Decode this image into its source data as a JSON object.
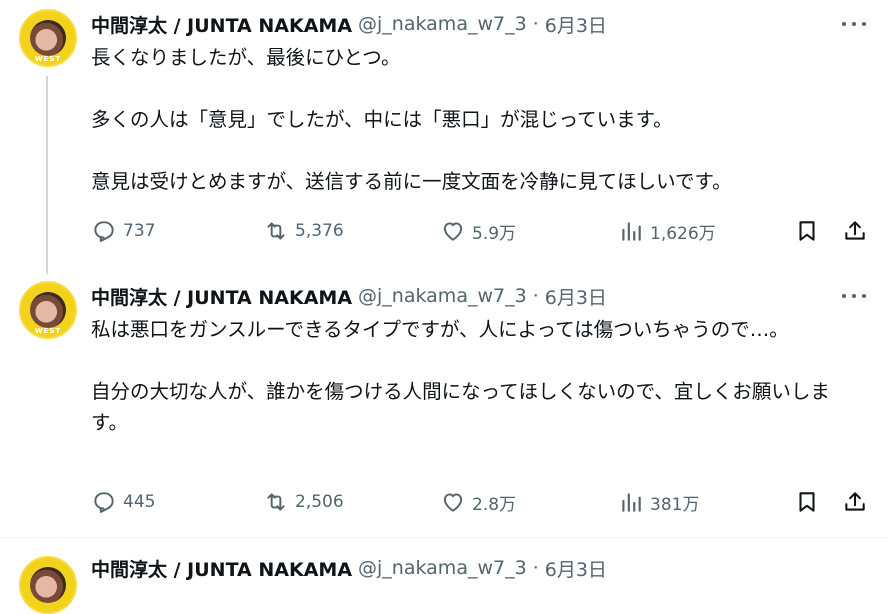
{
  "tweets": [
    {
      "author": "中間淳太 / JUNTA NAKAMA",
      "handle": "@j_nakama_w7_3",
      "separator": "·",
      "date": "6月3日",
      "paragraphs": [
        "長くなりましたが、最後にひとつ。",
        "多くの人は「意見」でしたが、中には「悪口」が混じっています。",
        "意見は受けとめますが、送信する前に一度文面を冷静に見てほしいです。"
      ],
      "replies": "737",
      "retweets": "5,376",
      "likes": "5.9万",
      "views": "1,626万"
    },
    {
      "author": "中間淳太 / JUNTA NAKAMA",
      "handle": "@j_nakama_w7_3",
      "separator": "·",
      "date": "6月3日",
      "paragraphs": [
        "私は悪口をガンスルーできるタイプですが、人によっては傷ついちゃうので…。",
        "自分の大切な人が、誰かを傷つける人間になってほしくないので、宜しくお願いします。"
      ],
      "replies": "445",
      "retweets": "2,506",
      "likes": "2.8万",
      "views": "381万"
    },
    {
      "author": "中間淳太 / JUNTA NAKAMA",
      "handle": "@j_nakama_w7_3",
      "separator": "·",
      "date": "6月3日"
    }
  ],
  "colors": {
    "text": "#0f1419",
    "secondary": "#536471",
    "avatar_bg": "#f3d21c",
    "thread_line": "#cfd9de"
  },
  "icons": [
    "reply-icon",
    "retweet-icon",
    "like-icon",
    "views-icon",
    "bookmark-icon",
    "share-icon",
    "more-icon"
  ]
}
